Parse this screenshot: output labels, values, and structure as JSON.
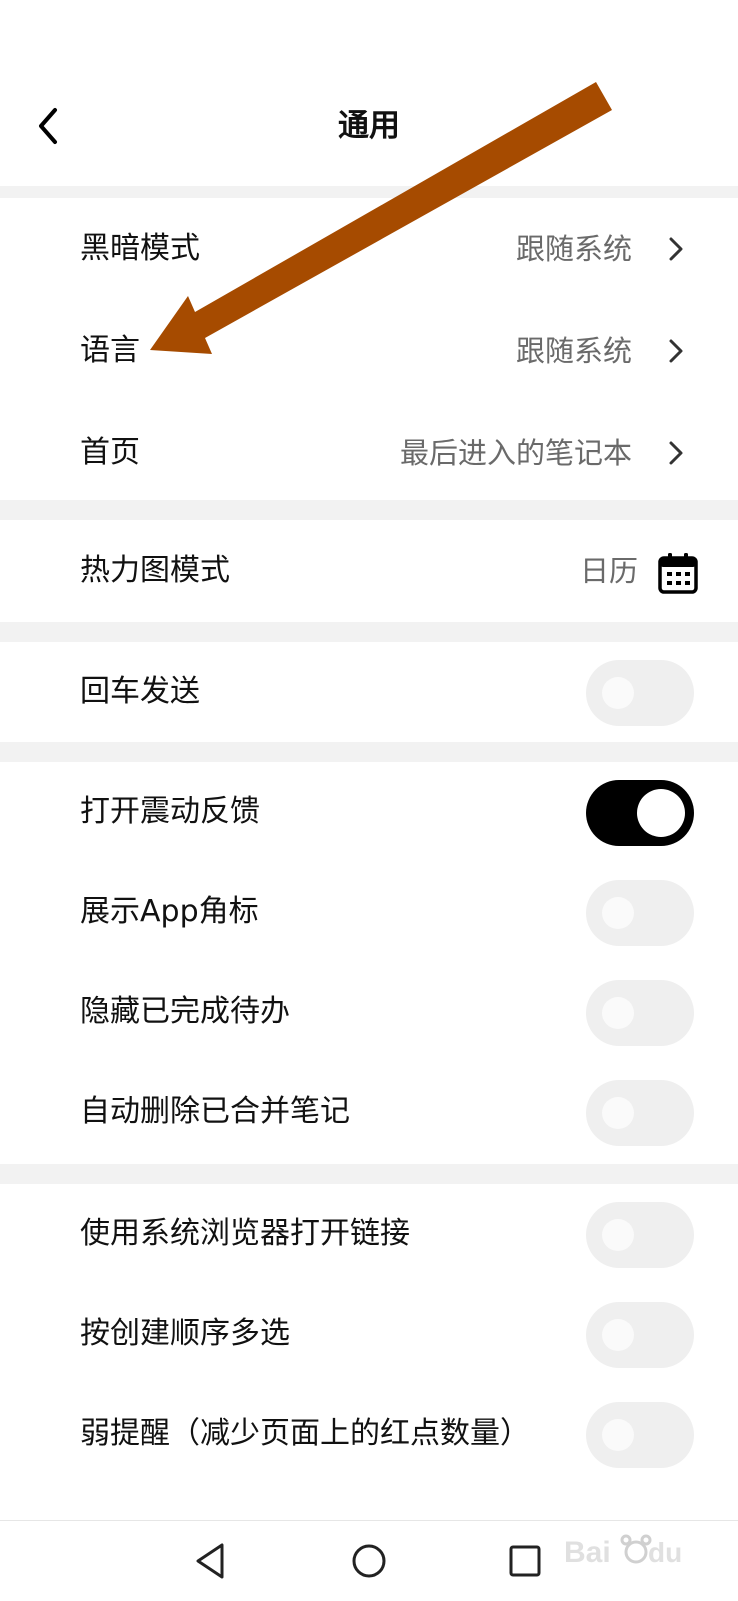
{
  "header": {
    "title": "通用"
  },
  "groups": {
    "appearance": {
      "dark_mode": {
        "label": "黑暗模式",
        "value": "跟随系统"
      },
      "language": {
        "label": "语言",
        "value": "跟随系统"
      },
      "home_page": {
        "label": "首页",
        "value": "最后进入的笔记本"
      }
    },
    "heatmap": {
      "label": "热力图模式",
      "value": "日历"
    },
    "enter_send": {
      "label": "回车发送",
      "enabled": false
    },
    "feedback": {
      "vibration": {
        "label": "打开震动反馈",
        "enabled": true
      },
      "app_badge": {
        "label": "展示App角标",
        "enabled": false
      },
      "hide_done_todos": {
        "label": "隐藏已完成待办",
        "enabled": false
      },
      "auto_delete_merged": {
        "label": "自动删除已合并笔记",
        "enabled": false
      }
    },
    "misc": {
      "system_browser": {
        "label": "使用系统浏览器打开链接",
        "enabled": false
      },
      "creation_order_select": {
        "label": "按创建顺序多选",
        "enabled": false
      },
      "weak_reminder": {
        "label": "弱提醒（减少页面上的红点数量）",
        "enabled": false
      }
    }
  },
  "annotation": {
    "arrow_color": "#a64b00"
  },
  "colors": {
    "accent_on": "#000000",
    "toggle_off": "#efefef",
    "value_text": "#6a6a6a"
  }
}
